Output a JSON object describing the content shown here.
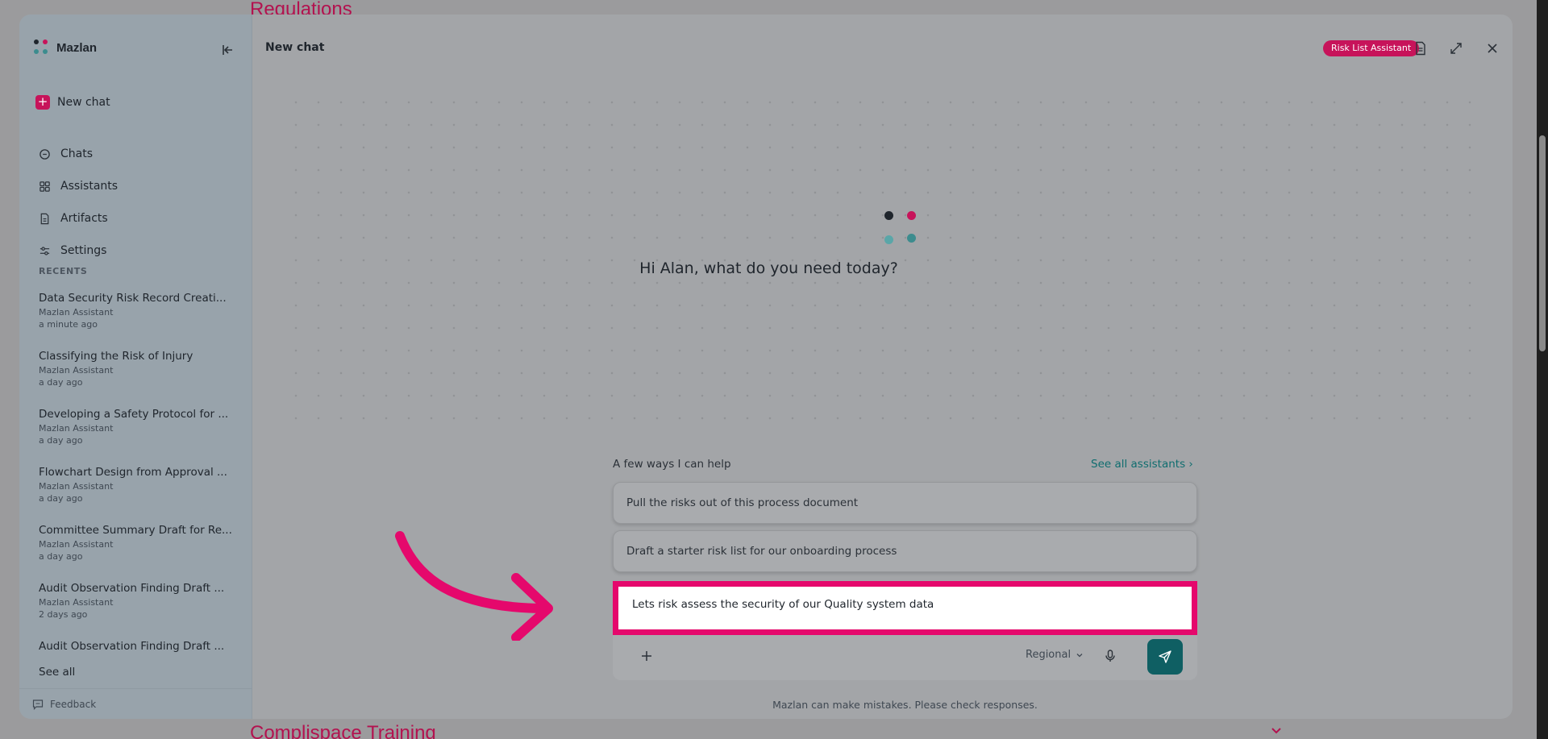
{
  "background": {
    "heading_top": "Regulations",
    "heading_bottom": "Complispace Training"
  },
  "sidebar": {
    "brand": "Mazlan",
    "new_chat_label": "New chat",
    "nav": [
      {
        "label": "Chats",
        "icon": "chat-icon"
      },
      {
        "label": "Assistants",
        "icon": "grid-icon"
      },
      {
        "label": "Artifacts",
        "icon": "document-icon"
      },
      {
        "label": "Settings",
        "icon": "sliders-icon"
      }
    ],
    "recents_label": "RECENTS",
    "recents": [
      {
        "title": "Data Security Risk Record Creati...",
        "assistant": "Mazlan Assistant",
        "time": "a minute ago"
      },
      {
        "title": "Classifying the Risk of Injury",
        "assistant": "Mazlan Assistant",
        "time": "a day ago"
      },
      {
        "title": "Developing a Safety Protocol for ...",
        "assistant": "Mazlan Assistant",
        "time": "a day ago"
      },
      {
        "title": "Flowchart Design from Approval ...",
        "assistant": "Mazlan Assistant",
        "time": "a day ago"
      },
      {
        "title": "Committee Summary Draft for Re...",
        "assistant": "Mazlan Assistant",
        "time": "a day ago"
      },
      {
        "title": "Audit Observation Finding Draft ...",
        "assistant": "Mazlan Assistant",
        "time": "2 days ago"
      },
      {
        "title": "Audit Observation Finding Draft ...",
        "assistant": "",
        "time": ""
      }
    ],
    "see_all": "See all",
    "feedback": "Feedback"
  },
  "header": {
    "title": "New chat",
    "assistant_badge": "Risk List Assistant"
  },
  "main": {
    "greeting": "Hi Alan, what do you need today?",
    "help_label": "A few ways I can help",
    "see_all_assistants": "See all assistants  ›",
    "suggestions": [
      "Pull the risks out of this process document",
      "Draft a starter risk list for our onboarding process"
    ],
    "input_value": "Lets risk assess the security of our Quality system data",
    "region": "Regional",
    "disclaimer": "Mazlan can make mistakes. Please check responses."
  },
  "colors": {
    "accent_pink": "#e5086c",
    "brand_magenta": "#c7135a",
    "teal": "#0f5f63",
    "link_teal": "#0f6d6f"
  }
}
